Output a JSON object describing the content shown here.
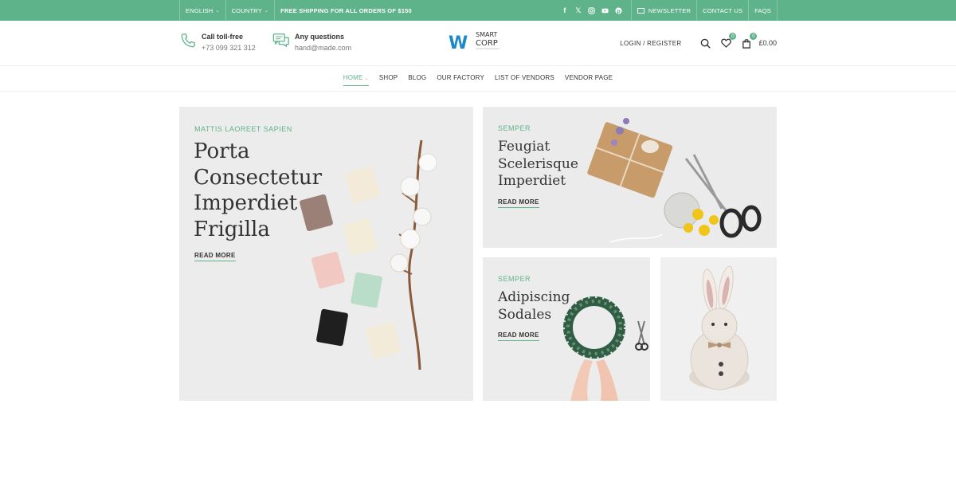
{
  "topbar": {
    "language": "ENGLISH",
    "country": "COUNTRY",
    "shipping": "FREE SHIPPING FOR ALL ORDERS OF $150",
    "newsletter": "NEWSLETTER",
    "contact": "CONTACT US",
    "faqs": "FAQS",
    "socials": [
      "facebook-icon",
      "x-icon",
      "instagram-icon",
      "youtube-icon",
      "pinterest-icon"
    ]
  },
  "header": {
    "phone_label": "Call toll-free",
    "phone_number": "+73 099 321 312",
    "question_label": "Any questions",
    "email": "hand@made.com",
    "logo_smart": "SMART",
    "logo_corp": "CORP",
    "logo_w": "W",
    "login": "LOGIN / REGISTER",
    "wishlist_count": "0",
    "cart_count": "0",
    "cart_total": "£0.00"
  },
  "nav": {
    "items": [
      "HOME",
      "SHOP",
      "BLOG",
      "OUR FACTORY",
      "LIST OF VENDORS",
      "VENDOR PAGE"
    ]
  },
  "banners": {
    "main": {
      "kicker": "MATTIS LAOREET SAPIEN",
      "title_lines": [
        "Porta",
        "Consectetur",
        "Imperdiet",
        "Frigilla"
      ],
      "link": "READ MORE"
    },
    "top_right": {
      "kicker": "SEMPER",
      "title_lines": [
        "Feugiat",
        "Scelerisque",
        "Imperdiet"
      ],
      "link": "READ MORE"
    },
    "bottom_left": {
      "kicker": "SEMPER",
      "title_lines": [
        "Adipiscing",
        "Sodales"
      ],
      "link": "READ MORE"
    }
  },
  "colors": {
    "accent": "#5fb38a",
    "text": "#333333"
  }
}
